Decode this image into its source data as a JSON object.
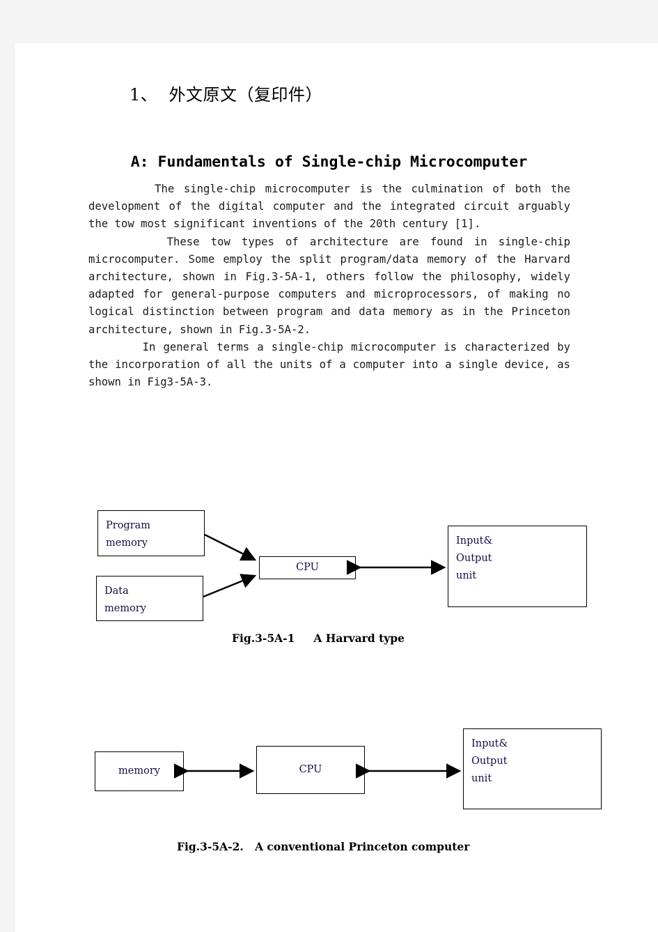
{
  "document": {
    "section_heading": "1、  外文原文（复印件）",
    "title": "A: Fundamentals of Single-chip Microcomputer",
    "paragraphs": [
      "       The single-chip microcomputer is the culmination of both the development of the digital computer and the integrated circuit arguably the tow most significant inventions of the 20th century [1].",
      "       These tow types of architecture are found in single-chip microcomputer. Some employ the split program/data memory of the Harvard architecture, shown in Fig.3-5A-1, others follow the philosophy, widely adapted for general-purpose computers and microprocessors, of making no logical distinction between program and data memory as in the Princeton architecture, shown in Fig.3-5A-2.",
      "       In general terms a single-chip microcomputer is characterized by the incorporation of all the units of a computer into a single device, as shown in Fig3-5A-3."
    ]
  },
  "figure1": {
    "caption": "Fig.3-5A-1     A Harvard type",
    "boxes": {
      "program_memory": "Program\nmemory",
      "data_memory": "Data\nmemory",
      "cpu": "CPU",
      "io_unit": "Input&\nOutput\nunit"
    }
  },
  "figure2": {
    "caption": "Fig.3-5A-2.   A conventional Princeton computer",
    "boxes": {
      "memory": "memory",
      "cpu": "CPU",
      "io_unit": "Input&\nOutput\nunit"
    }
  },
  "colors": {
    "page_background": "#ffffff",
    "outer_background": "#f4f4f4",
    "text": "#000000",
    "box_text": "#10104a",
    "stroke": "#000000"
  }
}
